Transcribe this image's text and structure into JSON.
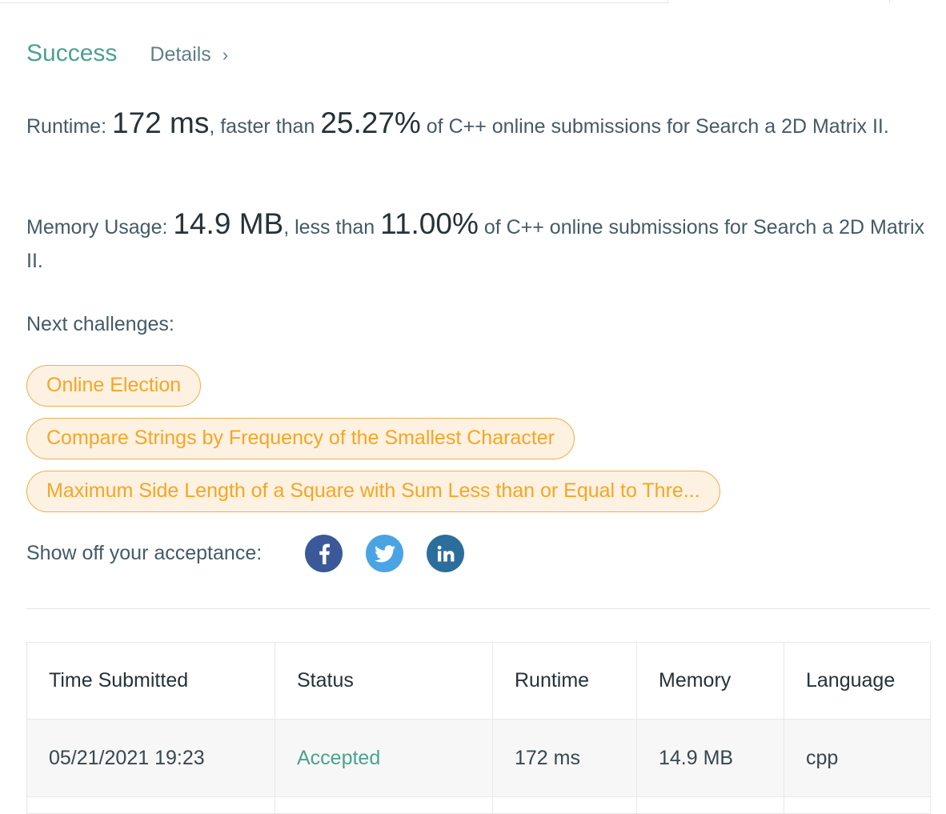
{
  "result": {
    "status": "Success",
    "details_label": "Details",
    "details_chevron": "›"
  },
  "runtime": {
    "label": "Runtime:",
    "value": "172 ms",
    "comparison": ", faster than",
    "percent": "25.27%",
    "suffix": "of C++ online submissions for Search a 2D Matrix II."
  },
  "memory": {
    "label": "Memory Usage:",
    "value": "14.9 MB",
    "comparison": ", less than",
    "percent": "11.00%",
    "suffix": "of C++ online submissions for Search a 2D Matrix II."
  },
  "next_challenges": {
    "label": "Next challenges:",
    "items": [
      "Online Election",
      "Compare Strings by Frequency of the Smallest Character",
      "Maximum Side Length of a Square with Sum Less than or Equal to Thre..."
    ]
  },
  "share": {
    "label": "Show off your acceptance:",
    "icons": [
      "facebook-icon",
      "twitter-icon",
      "linkedin-icon"
    ]
  },
  "submissions": {
    "columns": [
      "Time Submitted",
      "Status",
      "Runtime",
      "Memory",
      "Language"
    ],
    "rows": [
      {
        "time": "05/21/2021 19:23",
        "status": "Accepted",
        "runtime": "172 ms",
        "memory": "14.9 MB",
        "language": "cpp"
      }
    ]
  },
  "colors": {
    "success": "#4aa28f",
    "chip_text": "#f5a623",
    "chip_border": "#f0ad4e",
    "chip_bg": "#fdf1e2",
    "facebook": "#3b5998",
    "twitter": "#4aa4e4",
    "linkedin": "#2c6e9b"
  }
}
